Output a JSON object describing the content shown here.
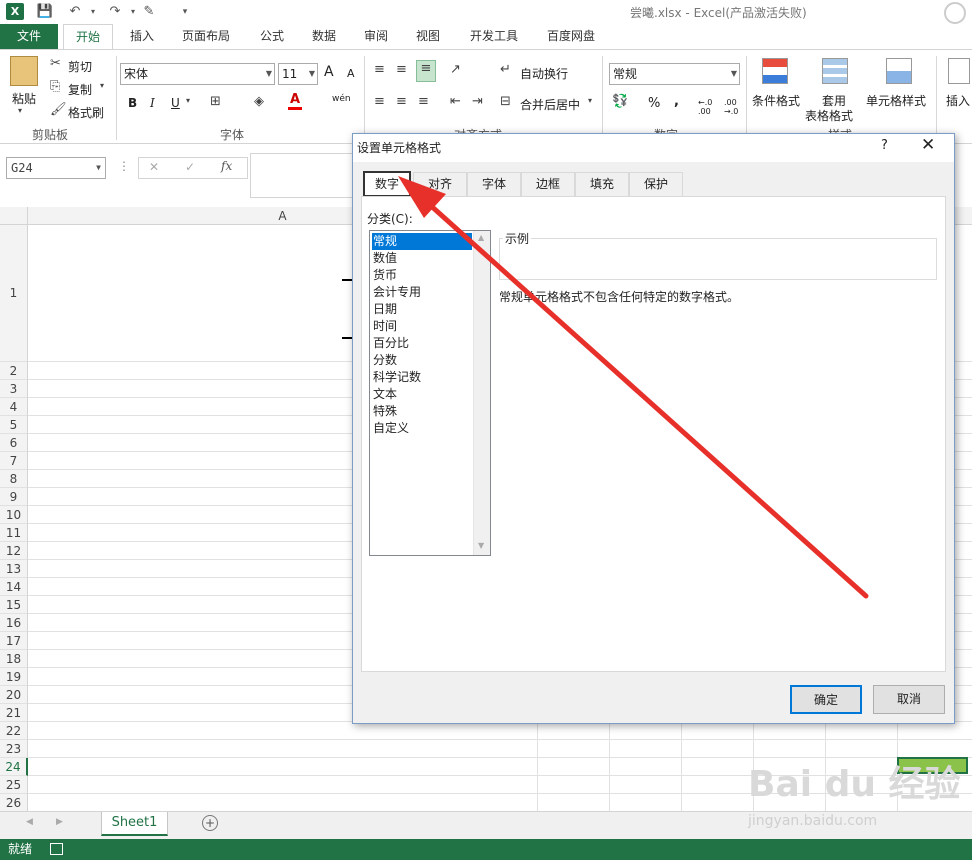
{
  "window": {
    "title": "尝曦.xlsx - Excel(产品激活失败)",
    "logo": "X"
  },
  "ribbon_tabs": [
    "文件",
    "开始",
    "插入",
    "页面布局",
    "公式",
    "数据",
    "审阅",
    "视图",
    "开发工具",
    "百度网盘"
  ],
  "clipboard": {
    "paste": "粘贴",
    "cut": "剪切",
    "copy": "复制",
    "format_painter": "格式刷",
    "group": "剪贴板"
  },
  "font": {
    "name": "宋体",
    "size": "11",
    "bold": "B",
    "italic": "I",
    "underline": "U",
    "group": "字体",
    "grow": "A",
    "shrink": "A",
    "wen": "wén"
  },
  "alignment": {
    "wrap": "自动换行",
    "merge": "合并后居中",
    "group": "对齐方式"
  },
  "number": {
    "format": "常规",
    "percent": "%",
    "comma": ",",
    "inc": "←.0 .00",
    "dec": ".00 →.0",
    "group": "数字"
  },
  "styles": {
    "conditional": "条件格式",
    "table_style_1": "套用",
    "table_style_2": "表格格式",
    "cell_styles": "单元格样式",
    "group": "样式"
  },
  "cells": {
    "insert": "插入"
  },
  "namebox": "G24",
  "formula": {
    "cancel": "✕",
    "enter": "✓",
    "fx": "fx"
  },
  "grid": {
    "col_a": "A",
    "rows": [
      "1",
      "2",
      "3",
      "4",
      "5",
      "6",
      "7",
      "8",
      "9",
      "10",
      "11",
      "12",
      "13",
      "14",
      "15",
      "16",
      "17",
      "18",
      "19",
      "20",
      "21",
      "22",
      "23",
      "24",
      "25",
      "26"
    ]
  },
  "sheet_tab": "Sheet1",
  "status": {
    "ready": "就绪"
  },
  "dialog": {
    "title": "设置单元格格式",
    "help": "?",
    "close": "✕",
    "tabs": [
      "数字",
      "对齐",
      "字体",
      "边框",
      "填充",
      "保护"
    ],
    "category_label": "分类(C):",
    "categories": [
      "常规",
      "数值",
      "货币",
      "会计专用",
      "日期",
      "时间",
      "百分比",
      "分数",
      "科学记数",
      "文本",
      "特殊",
      "自定义"
    ],
    "selected_category": "常规",
    "sample_label": "示例",
    "description": "常规单元格格式不包含任何特定的数字格式。",
    "ok": "确定",
    "cancel": "取消"
  },
  "watermark": {
    "brand": "Bai du 经验",
    "url": "jingyan.baidu.com"
  },
  "colors": {
    "excel_green": "#217346",
    "select_blue": "#0078d7",
    "arrow_red": "#e8302a",
    "cell_fill": "#8bc34a"
  }
}
